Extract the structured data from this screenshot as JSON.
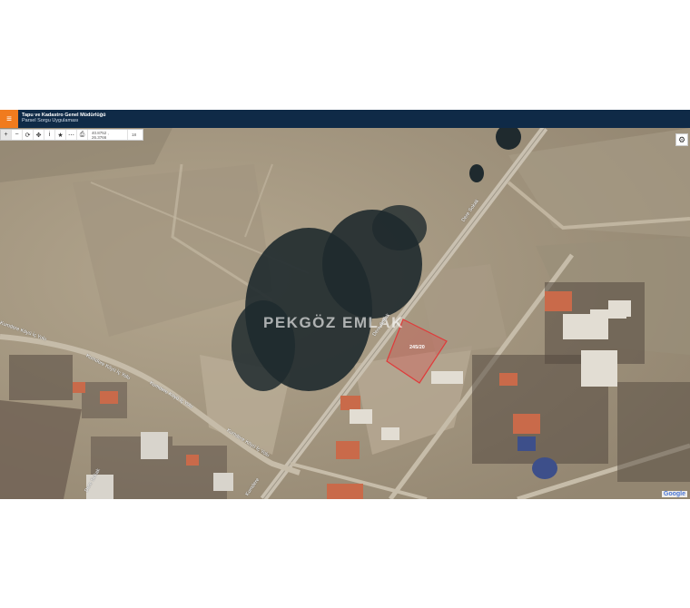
{
  "header": {
    "menu_icon": "hamburger-icon",
    "title": "Tapu ve Kadastro Genel Müdürlüğü",
    "subtitle": "Parsel Sorgu Uygulaması"
  },
  "toolbar": {
    "buttons": [
      "zoom-in-icon",
      "zoom-out-icon",
      "refresh-icon",
      "locate-icon",
      "info-icon",
      "star-icon",
      "measure-icon",
      "print-icon"
    ],
    "coordinates": "40.8752 , 26.3766",
    "zoom_level": "18"
  },
  "settings_icon": "gear-icon",
  "watermark": "PEKGÖZ EMLAK",
  "parcel": {
    "label": "245/20",
    "stroke_color": "#e03a3a"
  },
  "road_labels": {
    "road_a": "Dere Sokak",
    "road_b": "Dere Sokak",
    "road_c": "Kumdere Köyü İç Yolu",
    "road_d": "Kumdere Köyü İç Yolu",
    "road_e": "Kumdere Köyü İç Yolu",
    "road_f": "Kumdere Köyü İç Yolu",
    "road_g": "Dere Sokak",
    "road_h": "Kumdere"
  },
  "attribution": "Google"
}
